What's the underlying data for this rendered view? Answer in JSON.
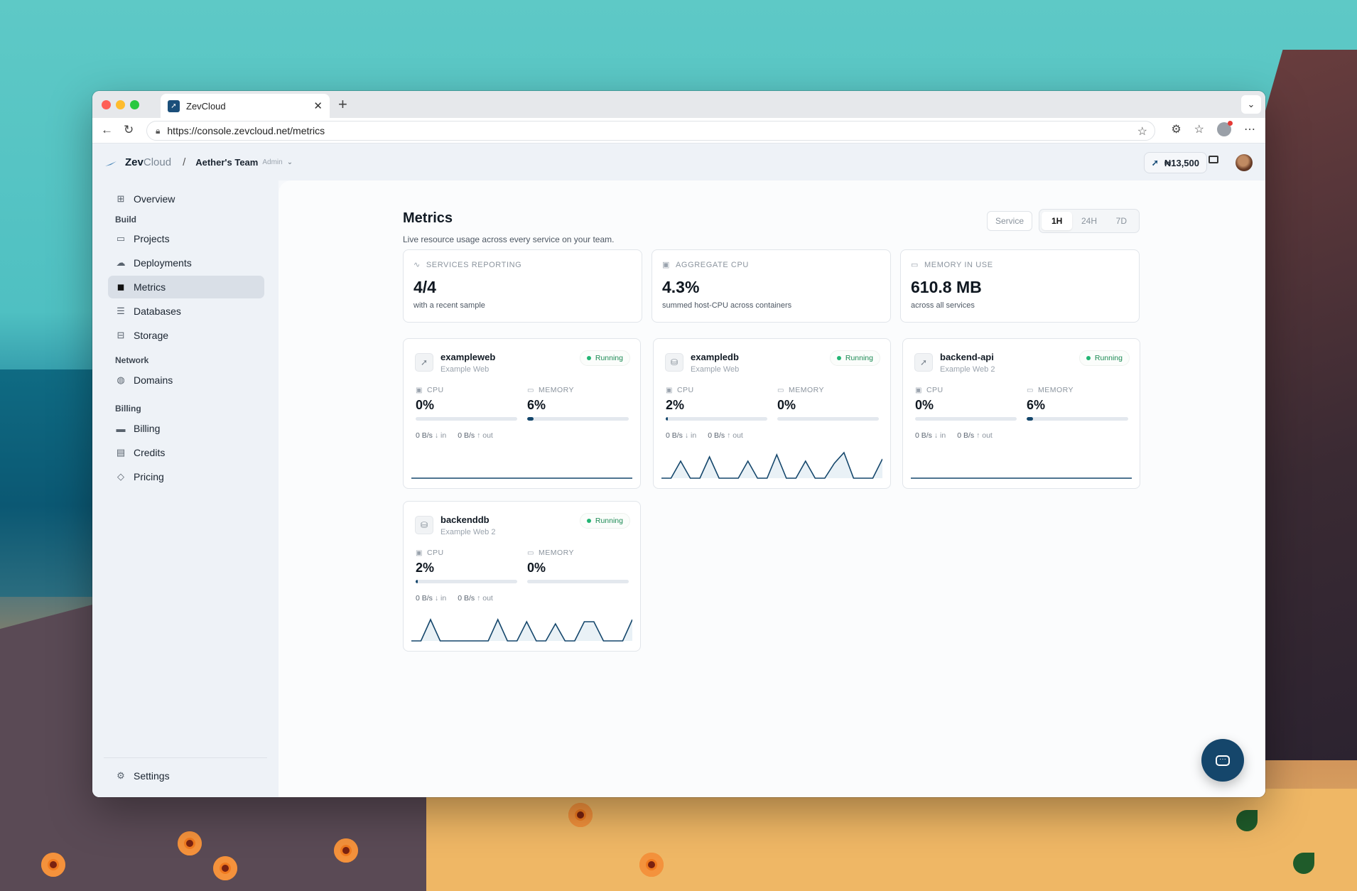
{
  "browser": {
    "tab_title": "ZevCloud",
    "url": "https://console.zevcloud.net/metrics"
  },
  "header": {
    "logo_primary": "Zev",
    "logo_secondary": "Cloud",
    "separator": "/",
    "team_name": "Aether's Team",
    "team_role": "Admin",
    "credits": "₦13,500"
  },
  "sidebar": {
    "overview": "Overview",
    "sections": {
      "build": "Build",
      "network": "Network",
      "billing": "Billing"
    },
    "items": {
      "projects": "Projects",
      "deployments": "Deployments",
      "metrics": "Metrics",
      "databases": "Databases",
      "storage": "Storage",
      "domains": "Domains",
      "billing": "Billing",
      "credits": "Credits",
      "pricing": "Pricing",
      "settings": "Settings"
    }
  },
  "page": {
    "title": "Metrics",
    "subtitle": "Live resource usage across every service on your team.",
    "service_filter": "Service",
    "ranges": [
      "1H",
      "24H",
      "7D"
    ],
    "active_range": "1H"
  },
  "stats": [
    {
      "label": "SERVICES REPORTING",
      "value": "4/4",
      "note": "with a recent sample"
    },
    {
      "label": "AGGREGATE CPU",
      "value": "4.3%",
      "note": "summed host-CPU across containers"
    },
    {
      "label": "MEMORY IN USE",
      "value": "610.8 MB",
      "note": "across all services"
    }
  ],
  "metric_labels": {
    "cpu": "CPU",
    "memory": "MEMORY",
    "in": "in",
    "out": "out"
  },
  "services": [
    {
      "name": "exampleweb",
      "project": "Example Web",
      "status": "Running",
      "cpu": "0%",
      "cpu_pct": 0,
      "memory": "6%",
      "memory_pct": 6,
      "net_in": "0 B/s",
      "net_out": "0 B/s",
      "spark": [
        0,
        0,
        0,
        0,
        0,
        0,
        0,
        0,
        0,
        0,
        0,
        0,
        0,
        0,
        0,
        0,
        0,
        0,
        0,
        0,
        0,
        0,
        0,
        0,
        0
      ]
    },
    {
      "name": "exampledb",
      "project": "Example Web",
      "status": "Running",
      "cpu": "2%",
      "cpu_pct": 2,
      "memory": "0%",
      "memory_pct": 0,
      "net_in": "0 B/s",
      "net_out": "0 B/s",
      "spark": [
        0,
        0,
        0.8,
        0,
        0,
        1,
        0,
        0,
        0,
        0.8,
        0,
        0,
        1.1,
        0,
        0,
        0.8,
        0,
        0,
        0.7,
        1.2,
        0,
        0,
        0,
        0.9
      ]
    },
    {
      "name": "backend-api",
      "project": "Example Web 2",
      "status": "Running",
      "cpu": "0%",
      "cpu_pct": 0,
      "memory": "6%",
      "memory_pct": 6,
      "net_in": "0 B/s",
      "net_out": "0 B/s",
      "spark": [
        0,
        0,
        0,
        0,
        0,
        0,
        0,
        0,
        0,
        0,
        0,
        0,
        0,
        0,
        0,
        0,
        0,
        0,
        0,
        0,
        0,
        0,
        0,
        0,
        0
      ]
    },
    {
      "name": "backenddb",
      "project": "Example Web 2",
      "status": "Running",
      "cpu": "2%",
      "cpu_pct": 2,
      "memory": "0%",
      "memory_pct": 0,
      "net_in": "0 B/s",
      "net_out": "0 B/s",
      "spark": [
        0,
        0,
        1,
        0,
        0,
        0,
        0,
        0,
        0,
        1,
        0,
        0,
        0.9,
        0,
        0,
        0.8,
        0,
        0,
        0.9,
        0.9,
        0,
        0,
        0,
        1
      ]
    }
  ],
  "colors": {
    "accent": "#14466b",
    "running": "#22b573",
    "active_nav": "#d9dfe7"
  },
  "icons": {
    "chat": "chat-bubble-icon",
    "reporting": "activity-icon",
    "cpu": "chip-icon",
    "memory": "memory-icon"
  }
}
